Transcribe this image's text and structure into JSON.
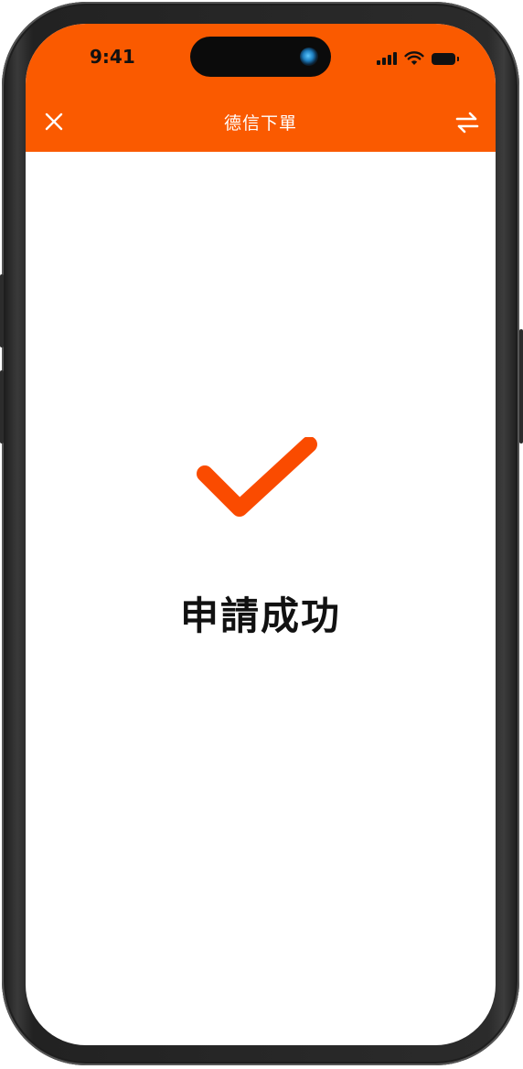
{
  "status_bar": {
    "time": "9:41",
    "icons": [
      "signal-icon",
      "wifi-icon",
      "battery-icon"
    ]
  },
  "nav": {
    "title": "德信下單",
    "left_icon": "close-icon",
    "right_icon": "switch-arrows-icon"
  },
  "result": {
    "icon": "checkmark-icon",
    "message": "申請成功"
  },
  "colors": {
    "header": "#fa5a00",
    "accent": "#fa4b00",
    "text": "#111111",
    "background": "#ffffff"
  }
}
